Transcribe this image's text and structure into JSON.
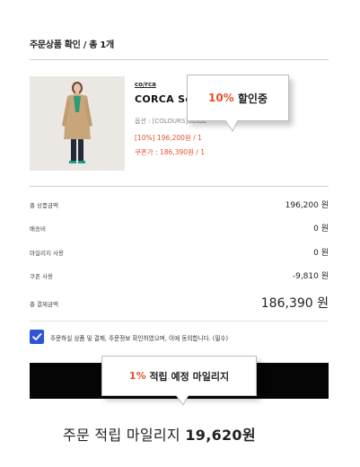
{
  "header": {
    "title": "주문상품 확인 / 총 1개"
  },
  "product": {
    "brand": "co/rca",
    "name": "CORCA Sc",
    "option": "옵션 : [COLOURS]BEIGE",
    "price_line": "[10%] 196,200원 / 1",
    "coupon_line": "쿠폰가 : 186,390원 / 1"
  },
  "summary": {
    "rows": [
      {
        "label": "총 상품금액",
        "value": "196,200 원"
      },
      {
        "label": "배송비",
        "value": "0 원"
      },
      {
        "label": "마일리지 사용",
        "value": "0 원"
      },
      {
        "label": "쿠폰 사용",
        "value": "-9,810 원"
      }
    ],
    "total": {
      "label": "총 결제금액",
      "value": "186,390 원"
    }
  },
  "agreement": {
    "text": "주문하실 상품 및 결제, 주문정보 확인하였으며, 이에 동의합니다. (필수)",
    "checked": true
  },
  "tooltips": {
    "discount": {
      "highlight": "10%",
      "text": " 할인중"
    },
    "mileage": {
      "highlight": "1%",
      "text": " 적립 예정 마일리지"
    }
  },
  "footer": {
    "prefix": "주문 적립 마일리지 ",
    "amount": "19,620원"
  },
  "colors": {
    "accent": "#e8502d",
    "checkbox": "#2f54d8",
    "button": "#050505"
  }
}
